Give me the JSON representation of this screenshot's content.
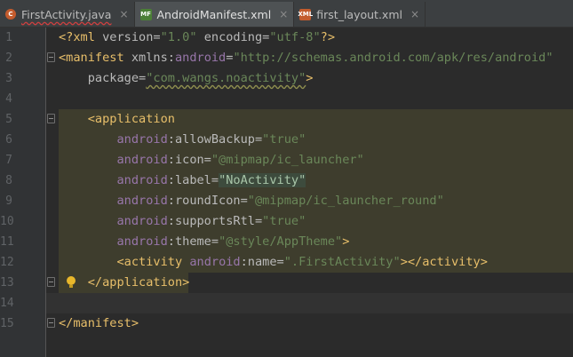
{
  "tabs": [
    {
      "icon": "java-file-icon",
      "badge": "C",
      "label": "FirstActivity.java",
      "close": "×"
    },
    {
      "icon": "manifest-file-icon",
      "badge": "MF",
      "label": "AndroidManifest.xml",
      "close": "×"
    },
    {
      "icon": "layout-file-icon",
      "badge": "XML",
      "label": "first_layout.xml",
      "close": "×"
    }
  ],
  "colors": {
    "tag": "#e8bf6a",
    "attr": "#bababa",
    "ns": "#9876aa",
    "string": "#6a8759",
    "text": "#a9b7c6"
  },
  "lines": [
    {
      "num": "1",
      "t": [
        [
          "tag",
          "<?xml "
        ],
        [
          "attr",
          "version="
        ],
        [
          "str",
          "\"1.0\""
        ],
        [
          "attr",
          " encoding="
        ],
        [
          "str",
          "\"utf-8\""
        ],
        [
          "tag",
          "?>"
        ]
      ]
    },
    {
      "num": "2",
      "t": [
        [
          "tag",
          "<manifest "
        ],
        [
          "attr",
          "xmlns:"
        ],
        [
          "ns",
          "android"
        ],
        [
          "attr",
          "="
        ],
        [
          "str",
          "\"http://schemas.android.com/apk/res/android\""
        ]
      ]
    },
    {
      "num": "3",
      "t": [
        [
          "attr",
          "    package="
        ],
        [
          "str",
          "\"com.wangs.noactivity\""
        ],
        [
          "tag",
          ">"
        ]
      ]
    },
    {
      "num": "4",
      "t": []
    },
    {
      "num": "5",
      "t": [
        [
          "tag",
          "    <application"
        ]
      ]
    },
    {
      "num": "6",
      "t": [
        [
          "ns",
          "        android"
        ],
        [
          "attr",
          ":allowBackup="
        ],
        [
          "str",
          "\"true\""
        ]
      ]
    },
    {
      "num": "7",
      "t": [
        [
          "ns",
          "        android"
        ],
        [
          "attr",
          ":icon="
        ],
        [
          "str",
          "\"@mipmap/ic_launcher\""
        ]
      ]
    },
    {
      "num": "8",
      "t": [
        [
          "ns",
          "        android"
        ],
        [
          "attr",
          ":label="
        ],
        [
          "sel",
          "\"NoActivity\""
        ]
      ]
    },
    {
      "num": "9",
      "t": [
        [
          "ns",
          "        android"
        ],
        [
          "attr",
          ":roundIcon="
        ],
        [
          "str",
          "\"@mipmap/ic_launcher_round\""
        ]
      ]
    },
    {
      "num": "10",
      "t": [
        [
          "ns",
          "        android"
        ],
        [
          "attr",
          ":supportsRtl="
        ],
        [
          "str",
          "\"true\""
        ]
      ]
    },
    {
      "num": "11",
      "t": [
        [
          "ns",
          "        android"
        ],
        [
          "attr",
          ":theme="
        ],
        [
          "str",
          "\"@style/AppTheme\""
        ],
        [
          "tag",
          ">"
        ]
      ]
    },
    {
      "num": "12",
      "t": [
        [
          "tag",
          "        <activity "
        ],
        [
          "ns",
          "android"
        ],
        [
          "attr",
          ":name="
        ],
        [
          "str",
          "\".FirstActivity\""
        ],
        [
          "tag",
          "></activity>"
        ]
      ]
    },
    {
      "num": "13",
      "t": [
        [
          "tag",
          "    </application>"
        ]
      ]
    },
    {
      "num": "14",
      "t": []
    },
    {
      "num": "15",
      "t": [
        [
          "tag",
          "</manifest>"
        ]
      ]
    }
  ]
}
